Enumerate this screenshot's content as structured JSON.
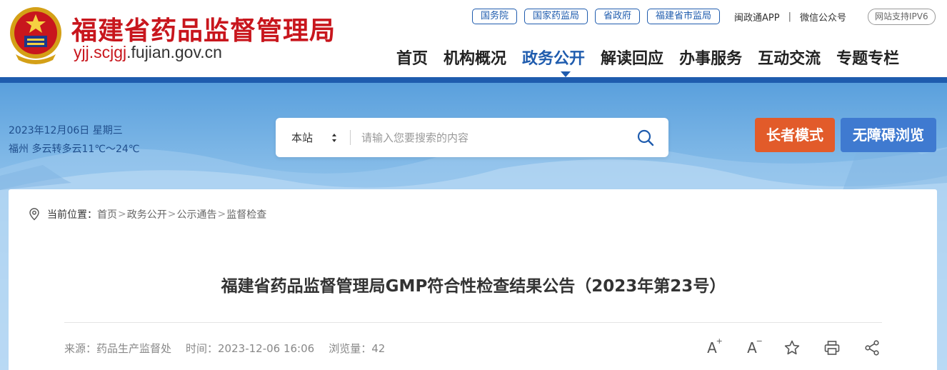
{
  "header": {
    "site_title": "福建省药品监督管理局",
    "domain_highlight": "yjj.scjgj",
    "domain_rest": ".fujian.gov.cn",
    "top_links": [
      "国务院",
      "国家药监局",
      "省政府",
      "福建省市监局"
    ],
    "app_label": "闽政通APP",
    "wechat_label": "微信公众号",
    "separator": "|",
    "ipv6_label": "网站支持IPV6"
  },
  "nav": {
    "items": [
      {
        "label": "首页",
        "active": false
      },
      {
        "label": "机构概况",
        "active": false
      },
      {
        "label": "政务公开",
        "active": true
      },
      {
        "label": "解读回应",
        "active": false
      },
      {
        "label": "办事服务",
        "active": false
      },
      {
        "label": "互动交流",
        "active": false
      },
      {
        "label": "专题专栏",
        "active": false
      }
    ]
  },
  "banner": {
    "date": "2023年12月06日 星期三",
    "weather": "福州 多云转多云11℃～24℃",
    "search": {
      "scope": "本站",
      "placeholder": "请输入您要搜索的内容"
    },
    "elder_mode": "长者模式",
    "accessibility": "无障碍浏览"
  },
  "breadcrumb": {
    "prefix": "当前位置：",
    "items": [
      "首页",
      "政务公开",
      "公示通告",
      "监督检查"
    ],
    "separator": ">"
  },
  "article": {
    "title": "福建省药品监督管理局GMP符合性检查结果公告（2023年第23号）",
    "source": "来源：药品生产监督处",
    "time": "时间：2023-12-06 16:06",
    "views": "浏览量：42"
  },
  "tools": {
    "font_larger": "A",
    "font_larger_mark": "+",
    "font_smaller": "A",
    "font_smaller_mark": "−"
  },
  "colors": {
    "brand_red": "#c8161d",
    "brand_blue": "#1f5cae",
    "elder_orange": "#e25b2a",
    "access_blue": "#3f7ad0"
  },
  "icons": [
    "emblem-icon",
    "location-pin-icon",
    "search-icon",
    "sort-arrows-icon",
    "star-icon",
    "print-icon",
    "share-icon"
  ]
}
